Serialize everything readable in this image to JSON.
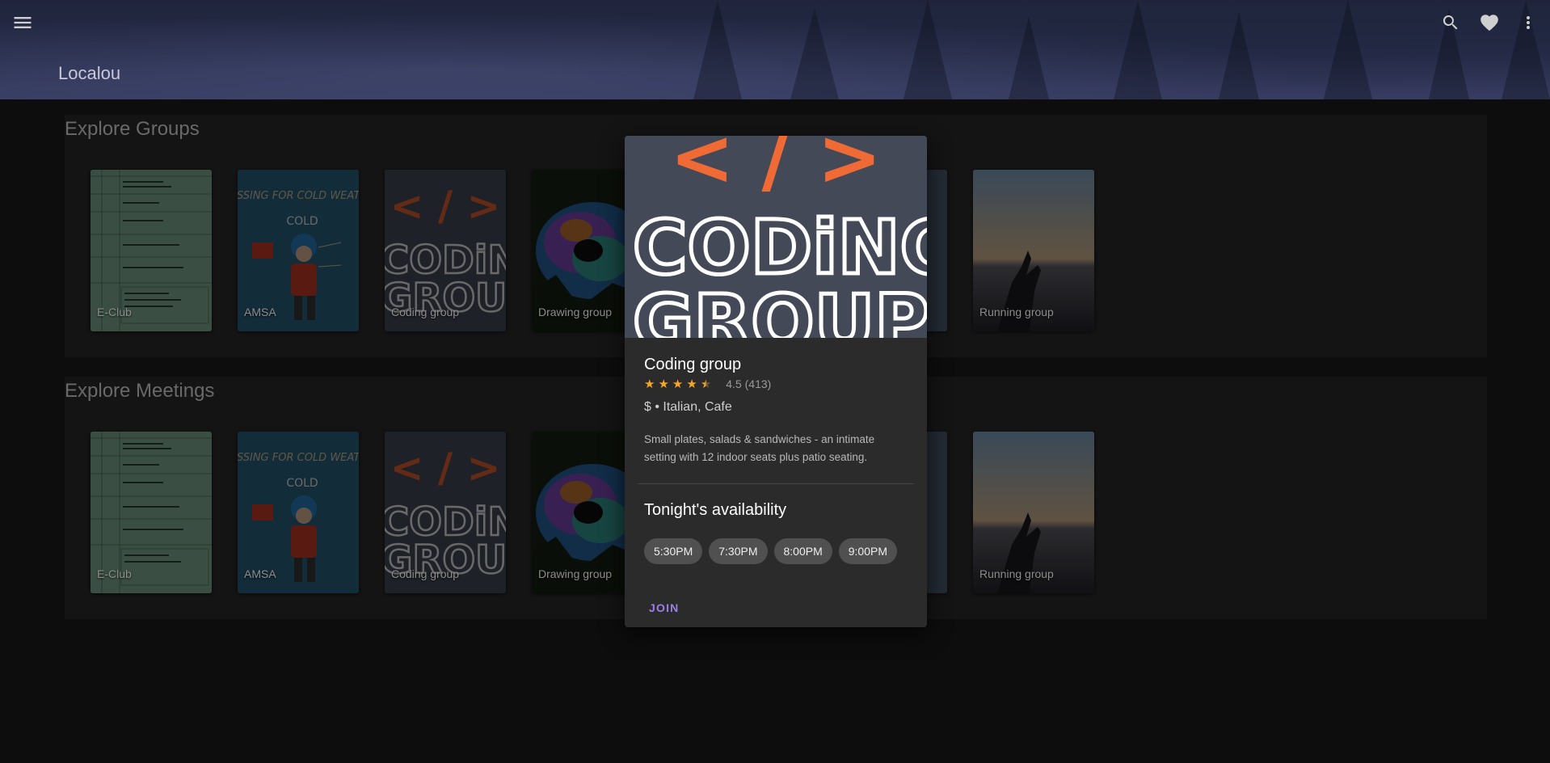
{
  "header": {
    "title": "Localou",
    "icons": {
      "menu": "menu-icon",
      "search": "search-icon",
      "favorite": "heart-icon",
      "more": "more-vert-icon"
    }
  },
  "groups": {
    "title": "Explore Groups",
    "cards": [
      {
        "label": "E-Club"
      },
      {
        "label": "AMSA"
      },
      {
        "label": "Coding group"
      },
      {
        "label": "Drawing group"
      },
      {
        "label": "Running group"
      }
    ]
  },
  "meetings": {
    "title": "Explore Meetings",
    "cards": [
      {
        "label": "E-Club"
      },
      {
        "label": "AMSA"
      },
      {
        "label": "Coding group"
      },
      {
        "label": "Drawing group"
      },
      {
        "label": "Running group"
      }
    ]
  },
  "art_text": {
    "amsa_banner": "DRESSING FOR COLD WEATHER",
    "amsa_cold": "COLD",
    "coding_line1": "CODiNG",
    "coding_line2": "GROUP",
    "code_symbol": "< / >"
  },
  "popup": {
    "name": "Coding group",
    "rating": 4.5,
    "rating_text": "4.5 (413)",
    "meta": "$ • Italian, Cafe",
    "description": "Small plates, salads & sandwiches - an intimate setting with 12 indoor seats plus patio seating.",
    "availability_title": "Tonight's availability",
    "times": [
      "5:30PM",
      "7:30PM",
      "8:00PM",
      "9:00PM"
    ],
    "join_label": "JOIN"
  },
  "colors": {
    "accent": "#9b7fe6",
    "star": "#f5a623",
    "coding_orange": "#f06a35"
  }
}
